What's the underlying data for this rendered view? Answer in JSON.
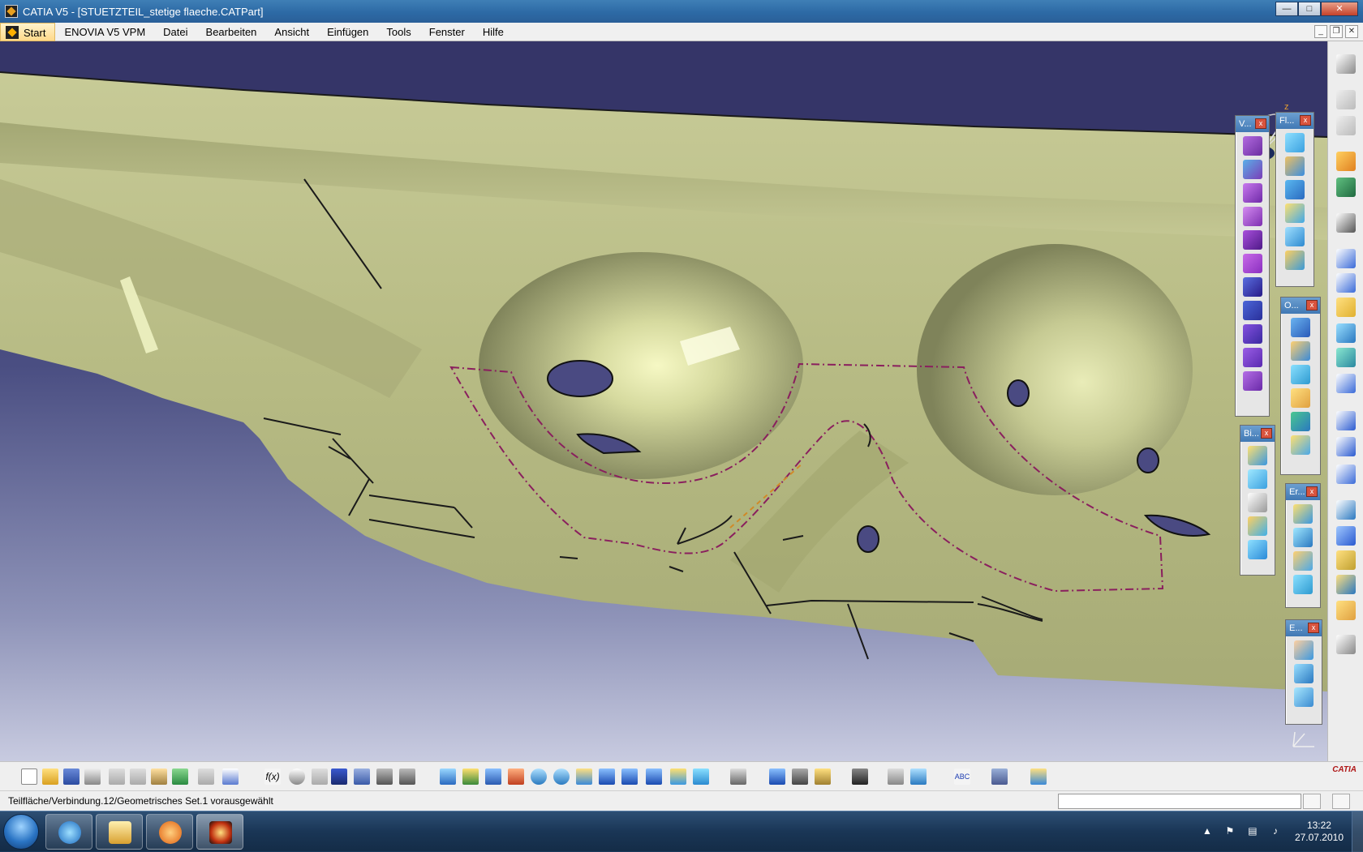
{
  "window": {
    "title": "CATIA V5 - [STUETZTEIL_stetige flaeche.CATPart]"
  },
  "menu": {
    "items": [
      "Start",
      "ENOVIA V5 VPM",
      "Datei",
      "Bearbeiten",
      "Ansicht",
      "Einfügen",
      "Tools",
      "Fenster",
      "Hilfe"
    ]
  },
  "floating_toolbars": [
    {
      "title": "V...",
      "icons": 11
    },
    {
      "title": "Fl...",
      "icons": 6
    },
    {
      "title": "O...",
      "icons": 6
    },
    {
      "title": "Bi...",
      "icons": 5
    },
    {
      "title": "Er...",
      "icons": 4
    },
    {
      "title": "E...",
      "icons": 3
    }
  ],
  "compass": {
    "axes": [
      "x",
      "y",
      "z"
    ]
  },
  "status": {
    "text": "Teilfläche/Verbindung.12/Geometrisches Set.1 vorausgewählt"
  },
  "branding": {
    "logo": "CATIA"
  },
  "taskbar": {
    "time": "13:22",
    "date": "27.07.2010"
  },
  "colors": {
    "part_surface": "#c8cc9a",
    "background_top": "#353568",
    "background_bottom": "#c8cbe0",
    "boundary_dashed": "#8a1f5e",
    "titlebar": "#2d6aa5"
  }
}
